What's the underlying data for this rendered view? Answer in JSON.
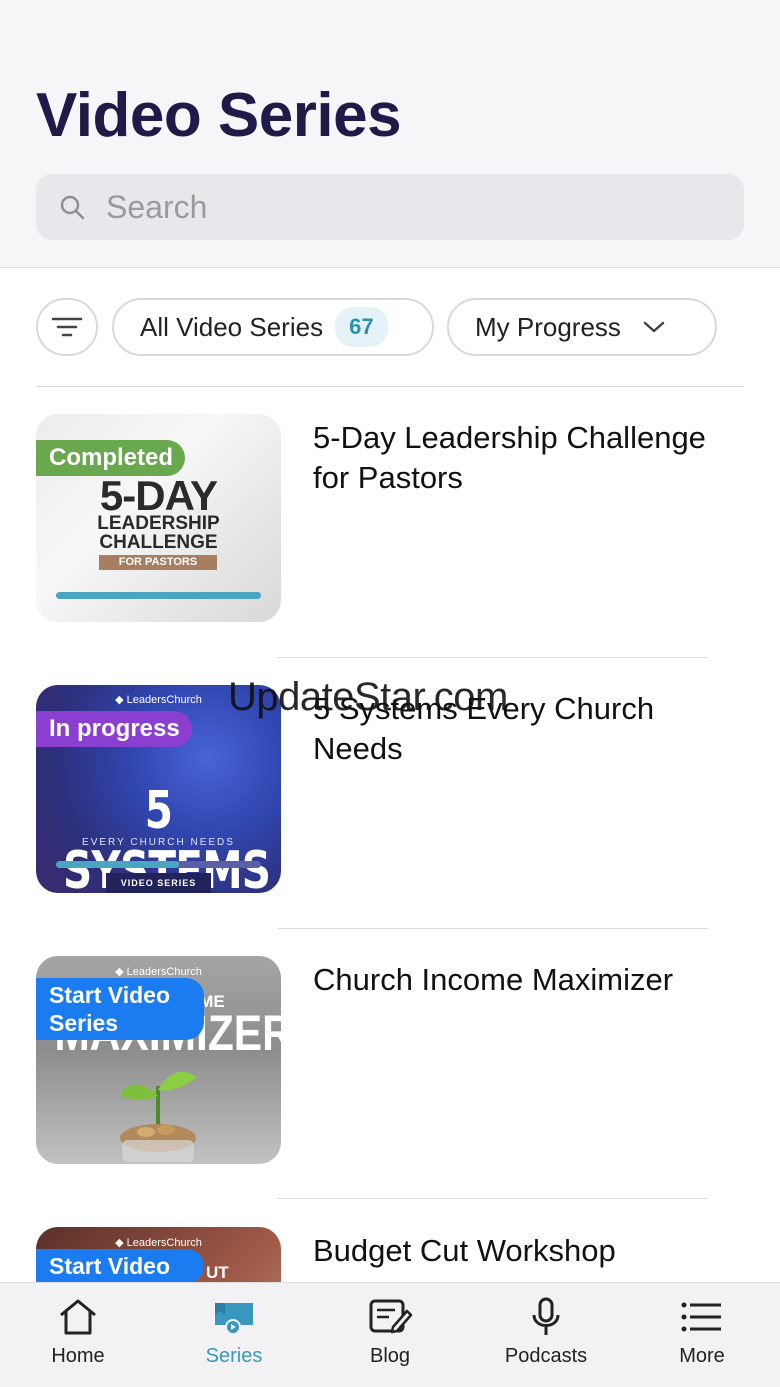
{
  "header": {
    "title": "Video Series",
    "search_placeholder": "Search"
  },
  "filters": {
    "all_label": "All Video Series",
    "all_count": "67",
    "progress_label": "My Progress"
  },
  "items": [
    {
      "title": "5-Day Leadership Challenge for Pastors",
      "status": "Completed",
      "status_color": "#6aa84f",
      "progress": 1.0,
      "thumb": {
        "line1": "5-DAY",
        "line2": "LEADERSHIP",
        "line3": "CHALLENGE",
        "tag": "FOR PASTORS"
      }
    },
    {
      "title": "5 Systems Every Church Needs",
      "status": "In progress",
      "status_color": "#8a3fd1",
      "progress": 0.6,
      "thumb": {
        "logo": "◆ LeadersChurch",
        "line1": "5 SYSTEMS",
        "line2": "EVERY CHURCH NEEDS",
        "tag": "VIDEO SERIES"
      }
    },
    {
      "title": "Church Income Maximizer",
      "status": "Start Video Series",
      "status_color": "#1a7cf0",
      "thumb": {
        "logo": "◆ LeadersChurch",
        "line1": "MAXIMIZER",
        "line2": "OME"
      }
    },
    {
      "title": "Budget Cut Workshop",
      "status": "Start Video",
      "status_color": "#1a7cf0",
      "thumb": {
        "logo": "◆ LeadersChurch",
        "line2": "UT"
      }
    }
  ],
  "watermark": "UpdateStar.com",
  "tabbar": {
    "active_color": "#3a97bd",
    "tabs": [
      {
        "label": "Home",
        "icon": "home-icon"
      },
      {
        "label": "Series",
        "icon": "series-icon"
      },
      {
        "label": "Blog",
        "icon": "blog-icon"
      },
      {
        "label": "Podcasts",
        "icon": "microphone-icon"
      },
      {
        "label": "More",
        "icon": "menu-icon"
      }
    ]
  }
}
